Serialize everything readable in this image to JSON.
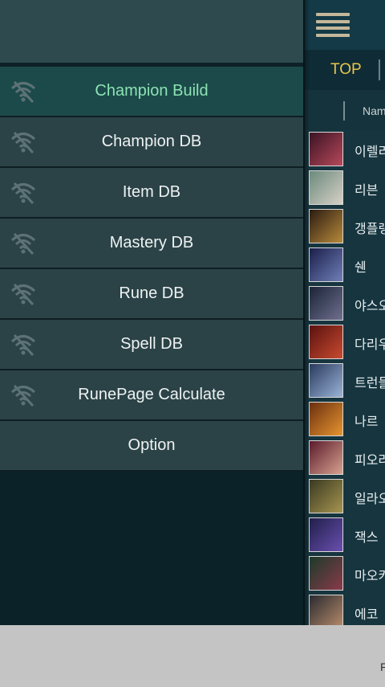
{
  "drawer": {
    "items": [
      {
        "label": "Champion Build",
        "active": true,
        "icon": "wifi-off-icon"
      },
      {
        "label": "Champion DB",
        "active": false,
        "icon": "wifi-off-icon"
      },
      {
        "label": "Item DB",
        "active": false,
        "icon": "wifi-off-icon"
      },
      {
        "label": "Mastery DB",
        "active": false,
        "icon": "wifi-off-icon"
      },
      {
        "label": "Rune DB",
        "active": false,
        "icon": "wifi-off-icon"
      },
      {
        "label": "Spell DB",
        "active": false,
        "icon": "wifi-off-icon"
      },
      {
        "label": "RunePage Calculate",
        "active": false,
        "icon": "wifi-off-icon"
      },
      {
        "label": "Option",
        "active": false,
        "icon": null
      }
    ]
  },
  "main": {
    "menu_icon": "hamburger-icon",
    "tab_label": "TOP",
    "column_header": "Name",
    "champions": [
      {
        "name": "이렐리아",
        "colors": [
          "#3a1424",
          "#b7485a"
        ]
      },
      {
        "name": "리븐",
        "colors": [
          "#6b8a7c",
          "#d7d0c6"
        ]
      },
      {
        "name": "갱플랭크",
        "colors": [
          "#2b1b12",
          "#b78a3a"
        ]
      },
      {
        "name": "쉔",
        "colors": [
          "#1a1f4a",
          "#6f7fb8"
        ]
      },
      {
        "name": "야스오",
        "colors": [
          "#1b2438",
          "#6f6f8e"
        ]
      },
      {
        "name": "다리우스",
        "colors": [
          "#5a1210",
          "#c94a2f"
        ]
      },
      {
        "name": "트런들",
        "colors": [
          "#2a3a5e",
          "#9ab4d8"
        ]
      },
      {
        "name": "나르",
        "colors": [
          "#6b2f10",
          "#e7952f"
        ]
      },
      {
        "name": "피오라",
        "colors": [
          "#5b1b2c",
          "#d7a28f"
        ]
      },
      {
        "name": "일라오이",
        "colors": [
          "#3a3a22",
          "#a69450"
        ]
      },
      {
        "name": "잭스",
        "colors": [
          "#201f4a",
          "#6a4fb0"
        ]
      },
      {
        "name": "마오카이",
        "colors": [
          "#1b3a2a",
          "#8a3a4a"
        ]
      },
      {
        "name": "에코",
        "colors": [
          "#2a2a30",
          "#b88c6a"
        ]
      }
    ]
  },
  "bottom_bar": {
    "text": "F"
  }
}
